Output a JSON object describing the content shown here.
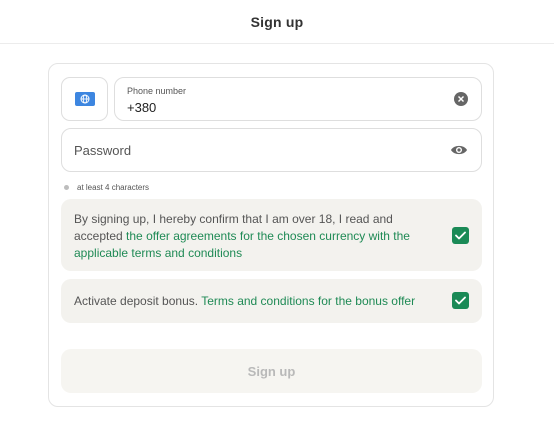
{
  "header": {
    "title": "Sign up"
  },
  "phone": {
    "label": "Phone number",
    "value": "+380"
  },
  "password": {
    "placeholder": "Password"
  },
  "hint": {
    "text": "at least 4 characters"
  },
  "consent_terms": {
    "prefix": "By signing up, I hereby confirm that I am over 18, I read and accepted ",
    "link": "the offer agreements for the chosen currency with the applicable terms and conditions",
    "checked": true
  },
  "consent_bonus": {
    "prefix": "Activate deposit bonus. ",
    "link": "Terms and conditions for the bonus offer",
    "checked": true
  },
  "submit": {
    "label": "Sign up",
    "enabled": false
  },
  "colors": {
    "accent": "#1a8a56",
    "link": "#1f8a55",
    "panel": "#f3f2ee",
    "flag": "#3d86e0"
  }
}
